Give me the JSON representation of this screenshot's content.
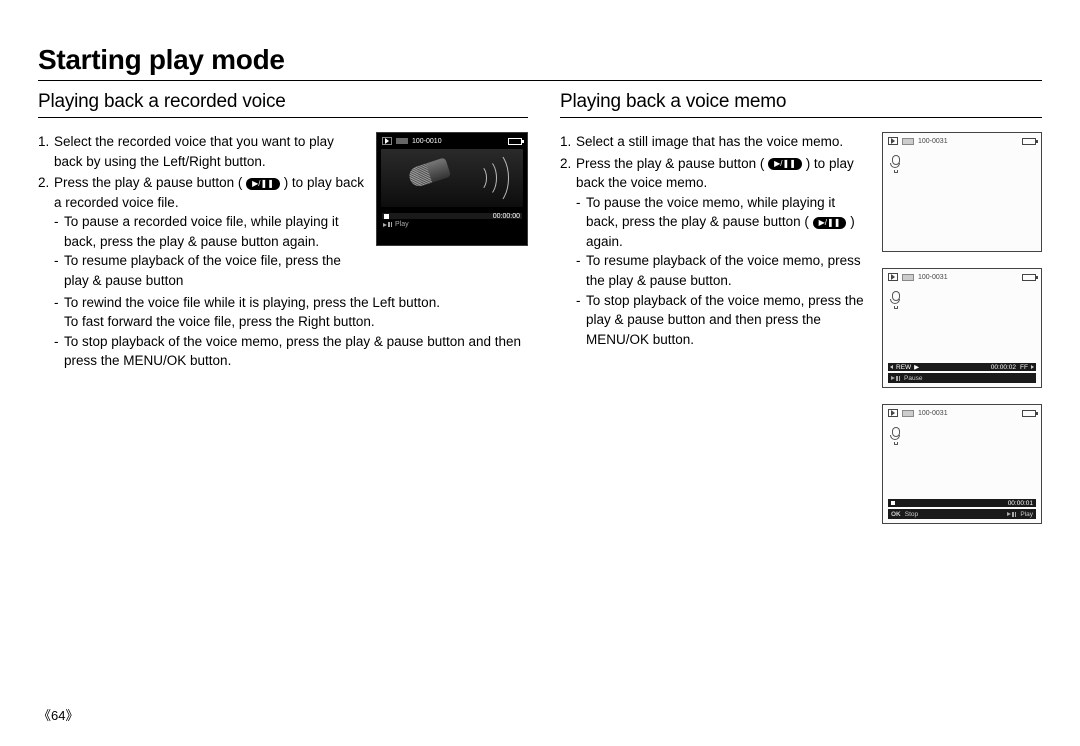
{
  "page": {
    "title": "Starting play mode",
    "page_number": "《64》"
  },
  "left": {
    "heading": "Playing back a recorded voice",
    "steps": {
      "s1": "Select the recorded voice that you want to play back by using the Left/Right button.",
      "s2_a": "Press the play & pause button (",
      "s2_b": ") to play back a recorded voice file."
    },
    "short_bullets": {
      "b1": "To pause a recorded voice file, while playing it back, press the play & pause button again.",
      "b2": "To resume playback of the voice file, press the play & pause button"
    },
    "wide_bullets": {
      "w1a": "To rewind the voice file while it is playing, press the Left button.",
      "w1b": "To fast forward the voice file, press the Right button.",
      "w2": "To stop playback of the voice memo, press the play & pause button and then press the MENU/OK button."
    },
    "lcd": {
      "file": "100-0010",
      "time": "00:00:00",
      "hint": "Play"
    }
  },
  "right": {
    "heading": "Playing back a voice memo",
    "steps": {
      "s1": "Select a still image that has the voice memo.",
      "s2_a": "Press the play & pause button (",
      "s2_b": ") to play back the voice memo."
    },
    "bullets": {
      "b1_a": "To pause the voice memo, while playing it back, press the play & pause button (",
      "b1_b": ") again.",
      "b2": "To resume playback of the voice memo, press the play & pause button.",
      "b3": "To stop playback of the voice memo, press the play & pause button and then press the MENU/OK button."
    },
    "lcd1": {
      "file": "100-0031"
    },
    "lcd2": {
      "file": "100-0031",
      "rew": "REW",
      "ff": "FF",
      "time": "00:00:02",
      "hint": "Pause"
    },
    "lcd3": {
      "file": "100-0031",
      "time": "00:00:01",
      "ok": "OK",
      "stop": "Stop",
      "play": "Play"
    }
  },
  "btn_glyph": "❚❚ ▶"
}
